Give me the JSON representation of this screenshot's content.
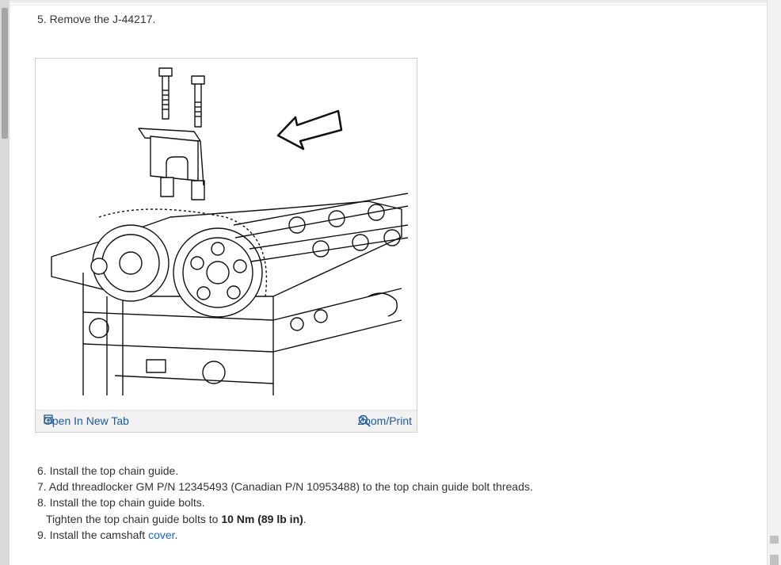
{
  "steps": {
    "step5": "5. Remove the J-44217.",
    "step6": "6. Install the top chain guide.",
    "step7": "7. Add threadlocker GM P/N 12345493 (Canadian P/N 10953488) to the top chain guide bolt threads.",
    "step8": "8. Install the top chain guide bolts.",
    "tighten_prefix": "Tighten the top chain guide bolts to ",
    "tighten_value": "10 Nm (89 lb in)",
    "tighten_suffix": ".",
    "step9_prefix": "9. Install the camshaft ",
    "step9_link": "cover",
    "step9_suffix": "."
  },
  "figure": {
    "open_label": "Open In New Tab",
    "zoom_label": "Zoom/Print",
    "open_icon": "open-new-tab-icon",
    "zoom_icon": "zoom-in-icon"
  },
  "colors": {
    "link": "#1f5c99",
    "footer_bg": "#f1f1f1"
  }
}
